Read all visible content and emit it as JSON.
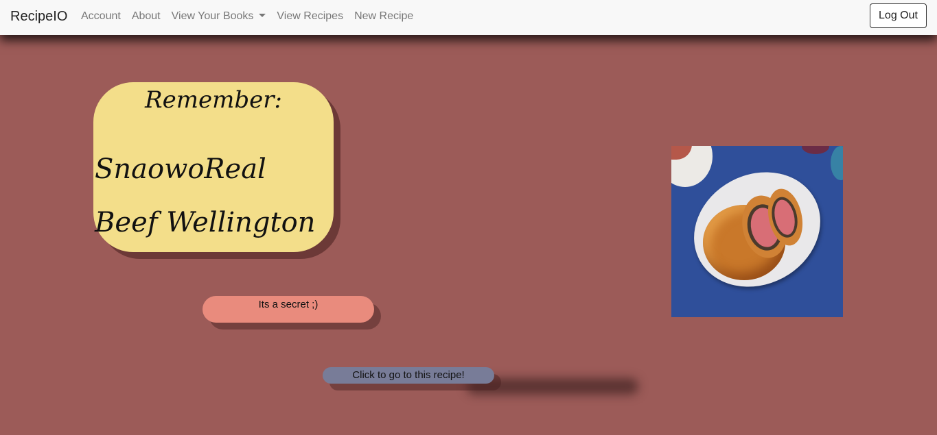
{
  "navbar": {
    "brand": "RecipeIO",
    "links": [
      "Account",
      "About",
      "View Your Books",
      "View Recipes",
      "New Recipe"
    ],
    "logout_label": "Log Out"
  },
  "card": {
    "heading": "Remember:",
    "recipe_name": "SnaowoReal Beef Wellington"
  },
  "secret_text": "Its a secret ;)",
  "link_text": "Click to go to this recipe!",
  "image": {
    "icon": "beef-wellington-photo"
  },
  "colors": {
    "background": "#9c5b58",
    "card": "#f3de8a",
    "secret_pill": "#e98b7d",
    "link_pill": "#787c98"
  }
}
